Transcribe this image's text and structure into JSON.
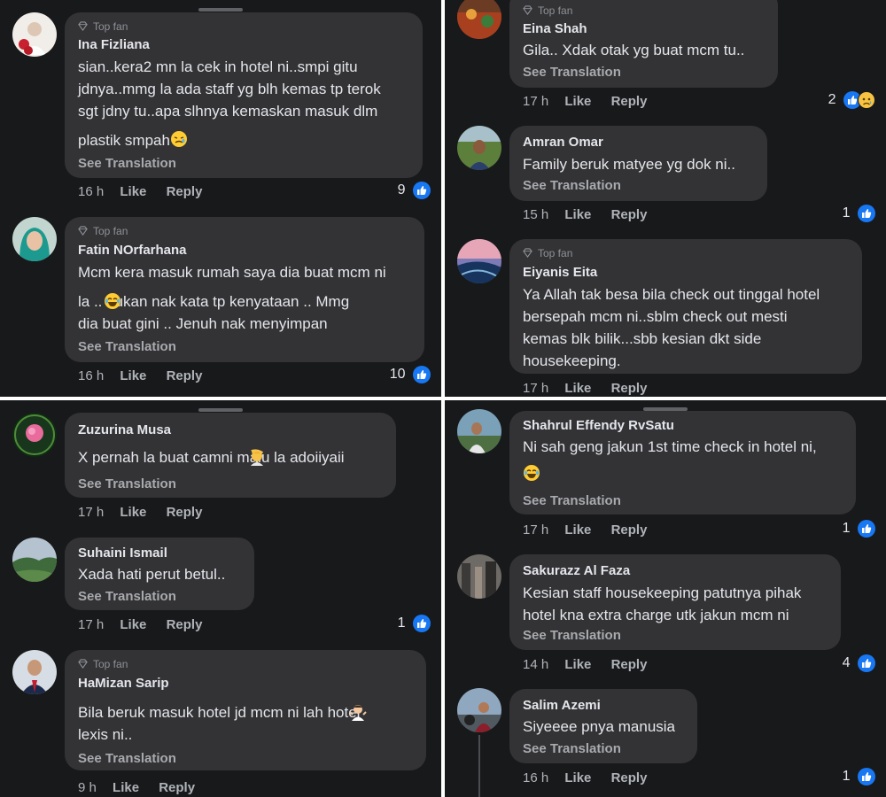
{
  "colors": {
    "panel_bg": "#18191b",
    "bubble_bg": "#333335",
    "text": "#e4e6eb",
    "muted": "#b0b3b8",
    "like_blue": "#1877f2"
  },
  "panels": [
    {
      "comments": [
        {
          "top_fan": "Top fan",
          "name": "Ina Fizliana",
          "lines": [
            "sian..kera2 mn la cek in hotel ni..smpi gitu",
            "jdnya..mmg la ada staff yg blh kemas tp terok",
            "sgt jdny tu..apa slhnya kemaskan masuk dlm",
            "plastik smpah"
          ],
          "translation": "See Translation",
          "time": "16 h",
          "like": "Like",
          "reply": "Reply",
          "reactions": "9"
        },
        {
          "top_fan": "Top fan",
          "name": "Fatin NOrfarhana",
          "lines": [
            "Mcm kera masuk rumah saya dia buat mcm ni",
            "la ..  bukan nak kata tp kenyataan .. Mmg",
            "dia buat gini .. Jenuh nak menyimpan"
          ],
          "translation": "See Translation",
          "time": "16 h",
          "like": "Like",
          "reply": "Reply",
          "reactions": "10"
        }
      ]
    },
    {
      "comments": [
        {
          "top_fan": "Top fan",
          "name": "Eina Shah",
          "lines": [
            "Gila.. Xdak otak yg buat mcm tu.."
          ],
          "translation": "See Translation",
          "time": "17 h",
          "like": "Like",
          "reply": "Reply",
          "reactions": "2"
        },
        {
          "top_fan": "",
          "name": "Amran Omar",
          "lines": [
            "Family beruk matyee yg dok ni.."
          ],
          "translation": "See Translation",
          "time": "15 h",
          "like": "Like",
          "reply": "Reply",
          "reactions": "1"
        },
        {
          "top_fan": "Top fan",
          "name": "Eiyanis Eita",
          "lines": [
            "Ya Allah tak besa bila check out tinggal hotel",
            "bersepah mcm ni..sblm check out mesti",
            "kemas blk bilik...sbb kesian dkt side",
            "housekeeping."
          ],
          "translation": "",
          "time": "17 h",
          "like": "Like",
          "reply": "Reply",
          "reactions": ""
        }
      ]
    },
    {
      "comments": [
        {
          "top_fan": "",
          "name": "Zuzurina Musa",
          "lines": [
            "X pernah la buat camni  malu la adoiiyaii"
          ],
          "translation": "See Translation",
          "time": "17 h",
          "like": "Like",
          "reply": "Reply",
          "reactions": ""
        },
        {
          "top_fan": "",
          "name": "Suhaini Ismail",
          "lines": [
            "Xada hati perut betul.."
          ],
          "translation": "See Translation",
          "time": "17 h",
          "like": "Like",
          "reply": "Reply",
          "reactions": "1"
        },
        {
          "top_fan": "Top fan",
          "name": "HaMizan Sarip",
          "lines": [
            "Bila beruk masuk hotel jd mcm ni lah    hotel",
            "lexis ni.."
          ],
          "translation": "See Translation",
          "time": "9 h",
          "like": "Like",
          "reply": "Reply",
          "reactions": ""
        }
      ]
    },
    {
      "comments": [
        {
          "top_fan": "",
          "name": "Shahrul Effendy RvSatu",
          "lines": [
            "Ni sah geng jakun 1st time check in hotel ni,",
            ""
          ],
          "translation": "See Translation",
          "time": "17 h",
          "like": "Like",
          "reply": "Reply",
          "reactions": "1"
        },
        {
          "top_fan": "",
          "name": "Sakurazz Al Faza",
          "lines": [
            "Kesian staff housekeeping patutnya pihak",
            "hotel kna extra charge utk jakun mcm ni"
          ],
          "translation": "See Translation",
          "time": "14 h",
          "like": "Like",
          "reply": "Reply",
          "reactions": "4"
        },
        {
          "top_fan": "",
          "name": "Salim Azemi",
          "lines": [
            "Siyeeee pnya manusia"
          ],
          "translation": "See Translation",
          "time": "16 h",
          "like": "Like",
          "reply": "Reply",
          "reactions": "1"
        }
      ]
    }
  ]
}
